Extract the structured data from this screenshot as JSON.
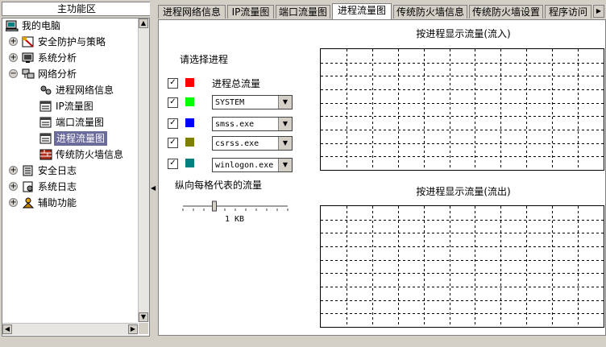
{
  "left_panel": {
    "title": "主功能区",
    "tree": [
      {
        "label": "我的电脑"
      },
      {
        "label": "安全防护与策略"
      },
      {
        "label": "系统分析"
      },
      {
        "label": "网络分析"
      },
      {
        "label": "进程网络信息"
      },
      {
        "label": "IP流量图"
      },
      {
        "label": "端口流量图"
      },
      {
        "label": "进程流量图"
      },
      {
        "label": "传统防火墙信息"
      },
      {
        "label": "安全日志"
      },
      {
        "label": "系统日志"
      },
      {
        "label": "辅助功能"
      }
    ]
  },
  "tabs": [
    {
      "label": "进程网络信息"
    },
    {
      "label": "IP流量图"
    },
    {
      "label": "端口流量图"
    },
    {
      "label": "进程流量图"
    },
    {
      "label": "传统防火墙信息"
    },
    {
      "label": "传统防火墙设置"
    },
    {
      "label": "程序访问"
    }
  ],
  "process_panel": {
    "heading": "请选择进程",
    "rows": [
      {
        "checked": true,
        "color": "#ff0000",
        "label": "进程总流量"
      },
      {
        "checked": true,
        "color": "#00ff00",
        "value": "SYSTEM"
      },
      {
        "checked": true,
        "color": "#0000ff",
        "value": "smss.exe"
      },
      {
        "checked": true,
        "color": "#808000",
        "value": "csrss.exe"
      },
      {
        "checked": true,
        "color": "#008080",
        "value": "winlogon.exe"
      }
    ],
    "scale_label": "纵向每格代表的流量",
    "scale_value": "1 KB",
    "scale_level": 0.3
  },
  "charts": {
    "in_title": "按进程显示流量(流入)",
    "out_title": "按进程显示流量(流出)"
  }
}
